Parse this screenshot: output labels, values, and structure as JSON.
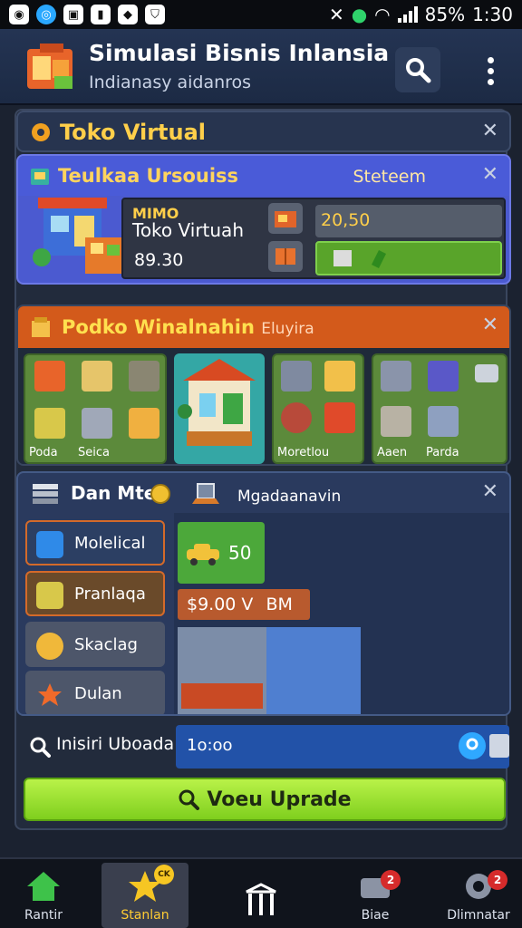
{
  "status_bar": {
    "battery": "85%",
    "time": "1:30"
  },
  "header": {
    "title": "Simulasi Bisnis Inlansia",
    "subtitle": "Indianasy aidanros"
  },
  "card_store": {
    "title": "Toko Virtual"
  },
  "card_business": {
    "title": "Teulkaa Ursouiss",
    "status": "Steteem",
    "tag": "MIMO",
    "name": "Toko Virtuah",
    "price": "89.30",
    "value": "20,50"
  },
  "card_products": {
    "title": "Podko Winalnahin",
    "title_extra": "Eluyira",
    "label_left_1": "Poda",
    "label_left_2": "Seica",
    "label_mid": "Moretlou",
    "label_right_1": "Aaen",
    "label_right_2": "Parda"
  },
  "card_market": {
    "title": "Dan Mte",
    "subtitle": "Mgadaanavin",
    "buttons": [
      {
        "label": "Molelical"
      },
      {
        "label": "Pranlaqa"
      },
      {
        "label": "Skaclag"
      },
      {
        "label": "Dulan"
      }
    ],
    "tile_value": "50",
    "price": "$9.00 V",
    "price_unit": "BM"
  },
  "search": {
    "label": "Inisiri Uboada",
    "value": "1o:oo"
  },
  "upgrade": {
    "label": "Voeu Uprade"
  },
  "bottom_nav": [
    {
      "label": "Rantir"
    },
    {
      "label": "Stanlan",
      "badge": "CK"
    },
    {
      "label": ""
    },
    {
      "label": "Biae",
      "badge": "2"
    },
    {
      "label": "Dlimnatar",
      "badge": "2"
    }
  ],
  "colors": {
    "accent": "#ffcf4a",
    "orange_header": "#d35a1b",
    "blue_card": "#4b5ad0",
    "green_button": "#8ad629"
  }
}
